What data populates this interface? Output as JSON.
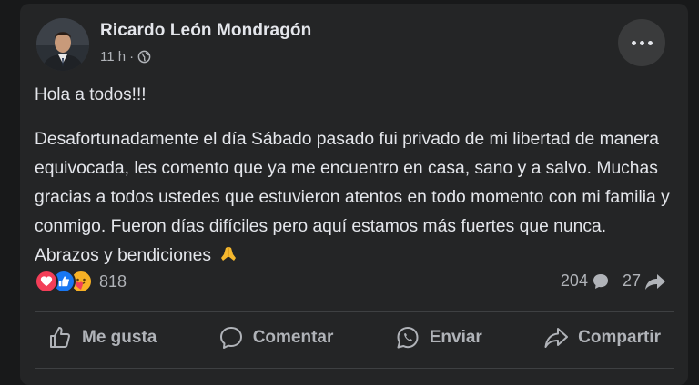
{
  "post": {
    "author": "Ricardo León Mondragón",
    "time": "11 h",
    "separator": "·",
    "privacy_icon": "globe-icon",
    "greeting": "Hola a todos!!!",
    "message": "Desafortunadamente el día Sábado pasado fui privado de mi libertad de manera equivocada, les comento que ya me encuentro en casa, sano y a salvo. Muchas gracias a todos ustedes que estuvieron atentos en todo momento con mi familia y conmigo. Fueron días difíciles pero aquí estamos más fuertes que nunca. Abrazos y bendiciones",
    "message_emoji": "folded-hands-icon"
  },
  "reactions": {
    "icons": [
      "love-icon",
      "like-icon",
      "care-icon"
    ],
    "count": "818"
  },
  "stats": {
    "comments": "204",
    "shares": "27"
  },
  "actions": {
    "like": "Me gusta",
    "comment": "Comentar",
    "send": "Enviar",
    "share": "Compartir"
  },
  "colors": {
    "background": "#18191a",
    "card": "#242526",
    "text": "#e4e6eb",
    "secondary_text": "#b0b3b8",
    "like_blue": "#1877f2",
    "love_red": "#f33e58"
  }
}
